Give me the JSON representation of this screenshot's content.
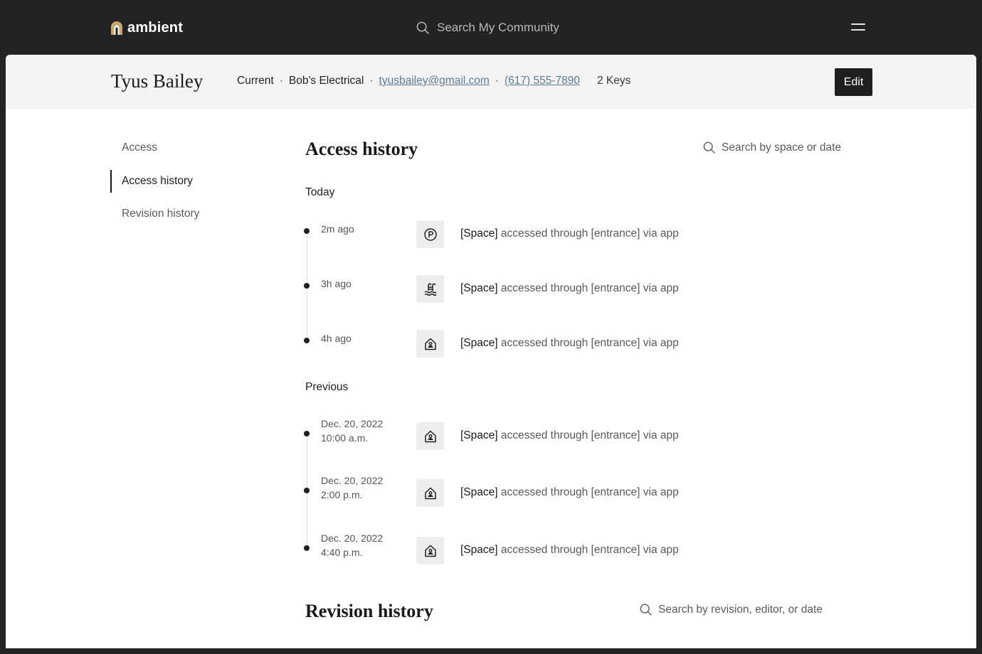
{
  "brand": {
    "name": "ambient"
  },
  "top_search": {
    "placeholder": "Search My Community"
  },
  "profile": {
    "name": "Tyus Bailey",
    "status": "Current",
    "company": "Bob's Electrical",
    "email": "tyusbailey@gmail.com",
    "phone": "(617) 555-7890",
    "keys": "2 Keys",
    "separator": "·",
    "edit_label": "Edit"
  },
  "sidenav": {
    "items": [
      {
        "label": "Access",
        "active": false
      },
      {
        "label": "Access history",
        "active": true
      },
      {
        "label": "Revision history",
        "active": false
      }
    ]
  },
  "access_history": {
    "title": "Access history",
    "search_placeholder": "Search by space or date",
    "groups": [
      {
        "label": "Today",
        "entries": [
          {
            "time": "2m ago",
            "icon": "parking-icon",
            "space": "[Space]",
            "text": "accessed through [entrance] via app"
          },
          {
            "time": "3h ago",
            "icon": "pool-icon",
            "space": "[Space]",
            "text": "accessed through [entrance] via app"
          },
          {
            "time": "4h ago",
            "icon": "home-person-icon",
            "space": "[Space]",
            "text": "accessed through [entrance] via app"
          }
        ]
      },
      {
        "label": "Previous",
        "entries": [
          {
            "date": "Dec. 20, 2022",
            "time": "10:00 a.m.",
            "icon": "home-person-icon",
            "space": "[Space]",
            "text": "accessed through [entrance] via app"
          },
          {
            "date": "Dec. 20, 2022",
            "time": "2:00 p.m.",
            "icon": "home-person-icon",
            "space": "[Space]",
            "text": "accessed through [entrance] via app"
          },
          {
            "date": "Dec. 20, 2022",
            "time": "4:40 p.m.",
            "icon": "home-person-icon",
            "space": "[Space]",
            "text": "accessed through [entrance] via app"
          }
        ]
      }
    ]
  },
  "revision_history": {
    "title": "Revision history",
    "search_placeholder": "Search by revision, editor, or date"
  },
  "colors": {
    "chrome": "#232325",
    "profile_bar": "#f4f4f4",
    "link": "#5c7b93",
    "logo_accent": "#c9a86b"
  }
}
